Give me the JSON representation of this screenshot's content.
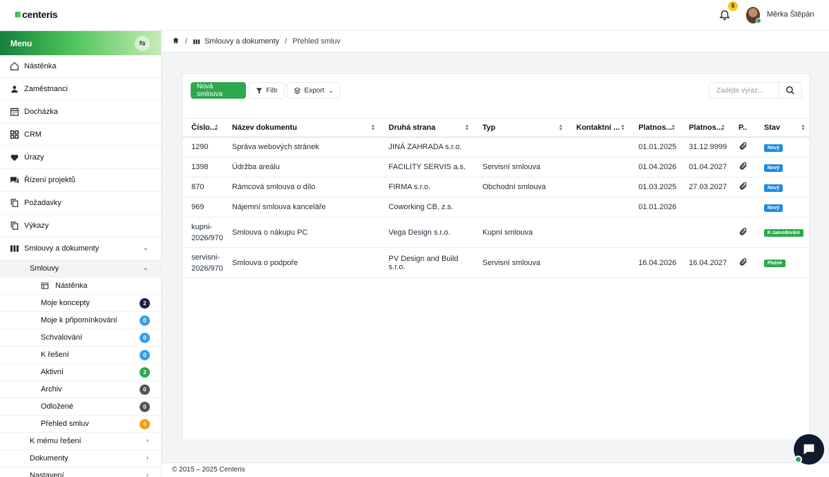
{
  "app": {
    "logo": "centeris"
  },
  "header": {
    "notification_count": "5",
    "user_name": "Měrka Štěpán"
  },
  "sidebar": {
    "title": "Menu",
    "items": [
      {
        "label": "Nástěnka",
        "icon": "home-icon"
      },
      {
        "label": "Zaměstnanci",
        "icon": "user-icon"
      },
      {
        "label": "Docházka",
        "icon": "calendar-icon"
      },
      {
        "label": "CRM",
        "icon": "grid-icon"
      },
      {
        "label": "Úrazy",
        "icon": "heart-icon"
      },
      {
        "label": "Řízení projektů",
        "icon": "chat-icon"
      },
      {
        "label": "Požadavky",
        "icon": "copy-icon"
      },
      {
        "label": "Výkazy",
        "icon": "copy-icon"
      },
      {
        "label": "Smlouvy a dokumenty",
        "icon": "contracts-icon"
      }
    ],
    "smlouvy_label": "Smlouvy",
    "sub_items": [
      {
        "label": "Nástěnka"
      },
      {
        "label": "Moje koncepty",
        "count": "2",
        "color": "#1e1b4b"
      },
      {
        "label": "Moje k připomínkování",
        "count": "0",
        "color": "#3b9ee8"
      },
      {
        "label": "Schvalování",
        "count": "0",
        "color": "#3b9ee8"
      },
      {
        "label": "K řešení",
        "count": "0",
        "color": "#3b9ee8"
      },
      {
        "label": "Aktivní",
        "count": "2",
        "color": "#2da84f"
      },
      {
        "label": "Archiv",
        "count": "0",
        "color": "#555555"
      },
      {
        "label": "Odložené",
        "count": "0",
        "color": "#555555"
      },
      {
        "label": "Přehled smluv",
        "count": "6",
        "color": "#f59e0b"
      }
    ],
    "more_items": [
      {
        "label": "K mému řešení"
      },
      {
        "label": "Dokumenty"
      },
      {
        "label": "Nastavení"
      }
    ]
  },
  "breadcrumb": {
    "section": "Smlouvy a dokumenty",
    "current": "Přehled smluv",
    "separator": "/"
  },
  "toolbar": {
    "new_label": "Nová smlouva",
    "filter_label": "Filtr",
    "export_label": "Export",
    "search_placeholder": "Zadejte výraz..."
  },
  "table": {
    "headers": [
      "Číslo...",
      "Název dokumentu",
      "Druhá strana",
      "Typ",
      "Kontaktní ...",
      "Platnos...",
      "Platnos...",
      "P..",
      "Stav"
    ],
    "rows": [
      {
        "cislo": "1290",
        "nazev": "Správa webových stránek",
        "strana": "JINÁ ZAHRADA s.r.o.",
        "typ": "",
        "kontakt": "",
        "od": "01.01.2025",
        "do": "31.12.9999",
        "priloha": true,
        "stav": "Nový",
        "stav_color": "#1d8ce0"
      },
      {
        "cislo": "1398",
        "nazev": "Údržba areálu",
        "strana": "FACILITY SERVIS a.s.",
        "typ": "Servisní smlouva",
        "kontakt": "",
        "od": "01.04.2026",
        "do": "01.04.2027",
        "priloha": true,
        "stav": "Nový",
        "stav_color": "#1d8ce0"
      },
      {
        "cislo": "870",
        "nazev": "Rámcová smlouva o dílo",
        "strana": "FIRMA s.r.o.",
        "typ": "Obchodní smlouva",
        "kontakt": "",
        "od": "01.03.2025",
        "do": "27.03.2027",
        "priloha": true,
        "stav": "Nový",
        "stav_color": "#1d8ce0"
      },
      {
        "cislo": "969",
        "nazev": "Nájemní smlouva kanceláře",
        "strana": "Coworking CB, z.s.",
        "typ": "",
        "kontakt": "",
        "od": "01.01.2026",
        "do": "",
        "priloha": false,
        "stav": "Nový",
        "stav_color": "#1d8ce0"
      },
      {
        "cislo": "kupni-2026/970",
        "nazev": "Smlouva o nákupu PC",
        "strana": "Vega Design s.r.o.",
        "typ": "Kupní smlouva",
        "kontakt": "",
        "od": "",
        "do": "",
        "priloha": true,
        "stav": "K zaevidování",
        "stav_color": "#2da84f"
      },
      {
        "cislo": "servisni-2026/970",
        "nazev": "Smlouva o podpoře",
        "strana": "PV Design and Build s.r.o.",
        "typ": "Servisní smlouva",
        "kontakt": "",
        "od": "16.04.2026",
        "do": "16.04.2027",
        "priloha": true,
        "stav": "Platné",
        "stav_color": "#2da84f"
      }
    ]
  },
  "footer": {
    "text": "© 2015 – 2025 Centeris"
  }
}
